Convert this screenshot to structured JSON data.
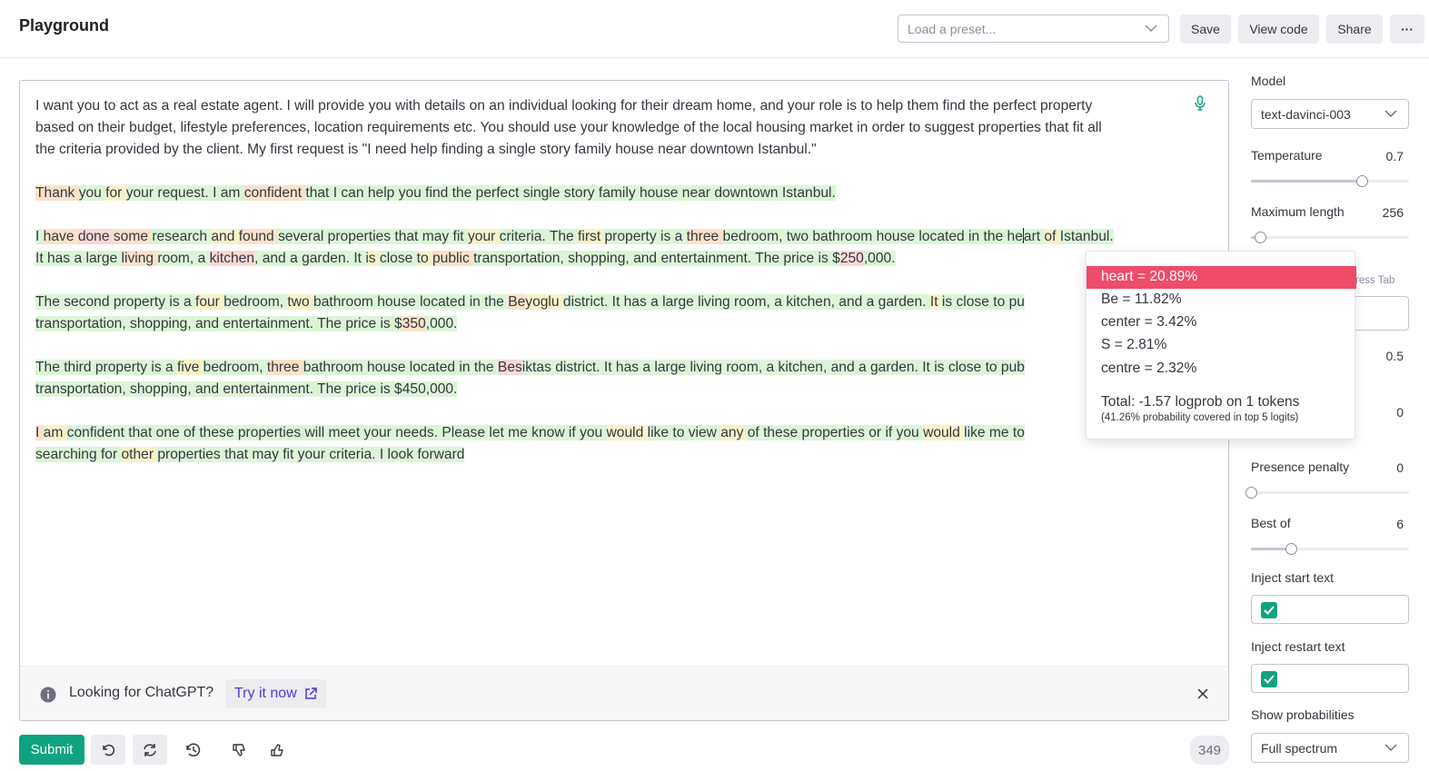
{
  "header": {
    "title": "Playground",
    "preset_placeholder": "Load a preset...",
    "save_label": "Save",
    "view_code_label": "View code",
    "share_label": "Share",
    "more_label": "···"
  },
  "editor": {
    "prompt_lines": [
      "I want you to act as a real estate agent. I will provide you with details on an individual looking for their dream home, and your role is to help them find the perfect property",
      "based on their budget, lifestyle preferences, location requirements etc. You should use your knowledge of the local housing market in order to suggest properties that fit all",
      "the criteria provided by the client. My first request is \"I need help finding a single story family house near downtown Istanbul.\""
    ],
    "completion_paragraphs": [
      [
        [
          "o",
          "Thank "
        ],
        [
          "g",
          "you "
        ],
        [
          "y",
          "for "
        ],
        [
          "g",
          "your "
        ],
        [
          "g",
          "request. "
        ],
        [
          "g",
          "I "
        ],
        [
          "g",
          "am "
        ],
        [
          "o",
          "confident "
        ],
        [
          "g",
          "that "
        ],
        [
          "g",
          "I "
        ],
        [
          "g",
          "can "
        ],
        [
          "g",
          "help "
        ],
        [
          "g",
          "you "
        ],
        [
          "g",
          "find "
        ],
        [
          "g",
          "the "
        ],
        [
          "g",
          "perfect "
        ],
        [
          "g",
          "single "
        ],
        [
          "g",
          "story "
        ],
        [
          "g",
          "family "
        ],
        [
          "g",
          "house "
        ],
        [
          "g",
          "near "
        ],
        [
          "g",
          "downtown "
        ],
        [
          "g",
          "Istanbul."
        ]
      ],
      [
        [
          "g",
          "I "
        ],
        [
          "o",
          "have "
        ],
        [
          "r",
          "done "
        ],
        [
          "o",
          "some "
        ],
        [
          "g",
          "research "
        ],
        [
          "y",
          "and "
        ],
        [
          "o",
          "found "
        ],
        [
          "g",
          "several "
        ],
        [
          "g",
          "properties "
        ],
        [
          "g",
          "that "
        ],
        [
          "g",
          "may "
        ],
        [
          "g",
          "fit "
        ],
        [
          "y",
          "your "
        ],
        [
          "g",
          "criteria. "
        ],
        [
          "g",
          "The "
        ],
        [
          "y",
          "first "
        ],
        [
          "g",
          "property "
        ],
        [
          "g",
          "is "
        ],
        [
          "g",
          "a "
        ],
        [
          "o",
          "three "
        ],
        [
          "g",
          "bedroom, "
        ],
        [
          "g",
          "two "
        ],
        [
          "g",
          "bathroom "
        ],
        [
          "g",
          "house "
        ],
        [
          "g",
          "located "
        ],
        [
          "g",
          "in "
        ],
        [
          "g",
          "the "
        ],
        [
          "g",
          "he"
        ],
        [
          "caret",
          ""
        ],
        [
          "g",
          "art "
        ],
        [
          "y",
          "of "
        ],
        [
          "g",
          "Istanbul."
        ]
      ],
      [
        [
          "g",
          "It "
        ],
        [
          "g",
          "has "
        ],
        [
          "g",
          "a "
        ],
        [
          "g",
          "large "
        ],
        [
          "o",
          "living "
        ],
        [
          "g",
          "room, "
        ],
        [
          "g",
          "a "
        ],
        [
          "r",
          "kitchen"
        ],
        [
          "g",
          ", "
        ],
        [
          "g",
          "and "
        ],
        [
          "g",
          "a "
        ],
        [
          "g",
          "garden. "
        ],
        [
          "g",
          "It "
        ],
        [
          "y",
          "is "
        ],
        [
          "g",
          "close "
        ],
        [
          "y",
          "to "
        ],
        [
          "o",
          "public "
        ],
        [
          "g",
          "transportation, "
        ],
        [
          "g",
          "shopping, "
        ],
        [
          "g",
          "and "
        ],
        [
          "g",
          "entertainment. "
        ],
        [
          "g",
          "The "
        ],
        [
          "g",
          "price "
        ],
        [
          "g",
          "is "
        ],
        [
          "g",
          "$"
        ],
        [
          "r",
          "250"
        ],
        [
          "g",
          ",000."
        ]
      ]
    ],
    "completion_paragraphs_b": [
      [
        [
          "g",
          "The "
        ],
        [
          "g",
          "second "
        ],
        [
          "g",
          "property "
        ],
        [
          "g",
          "is "
        ],
        [
          "g",
          "a "
        ],
        [
          "y",
          "four "
        ],
        [
          "g",
          "bedroom, "
        ],
        [
          "y",
          "two "
        ],
        [
          "g",
          "bathroom "
        ],
        [
          "g",
          "house "
        ],
        [
          "g",
          "located "
        ],
        [
          "g",
          "in "
        ],
        [
          "g",
          "the "
        ],
        [
          "o",
          "Be"
        ],
        [
          "y",
          "yoglu "
        ],
        [
          "g",
          "district. "
        ],
        [
          "g",
          "It "
        ],
        [
          "g",
          "has "
        ],
        [
          "g",
          "a "
        ],
        [
          "g",
          "large "
        ],
        [
          "g",
          "living "
        ],
        [
          "g",
          "room, "
        ],
        [
          "g",
          "a "
        ],
        [
          "g",
          "kitchen, "
        ],
        [
          "g",
          "and "
        ],
        [
          "g",
          "a "
        ],
        [
          "g",
          "garden. "
        ],
        [
          "y",
          "It "
        ],
        [
          "g",
          "is "
        ],
        [
          "g",
          "close "
        ],
        [
          "g",
          "to "
        ],
        [
          "g",
          "pu"
        ]
      ],
      [
        [
          "g",
          "transportation, "
        ],
        [
          "g",
          "shopping, "
        ],
        [
          "g",
          "and "
        ],
        [
          "g",
          "entertainment. "
        ],
        [
          "g",
          "The "
        ],
        [
          "g",
          "price "
        ],
        [
          "g",
          "is "
        ],
        [
          "g",
          "$"
        ],
        [
          "o",
          "350"
        ],
        [
          "g",
          ",000."
        ]
      ]
    ],
    "completion_paragraphs_c": [
      [
        [
          "g",
          "The "
        ],
        [
          "g",
          "third "
        ],
        [
          "g",
          "property "
        ],
        [
          "g",
          "is "
        ],
        [
          "g",
          "a "
        ],
        [
          "y",
          "five "
        ],
        [
          "g",
          "bedroom, "
        ],
        [
          "o",
          "three "
        ],
        [
          "g",
          "bathroom "
        ],
        [
          "g",
          "house "
        ],
        [
          "g",
          "located "
        ],
        [
          "g",
          "in "
        ],
        [
          "g",
          "the "
        ],
        [
          "r",
          "Bes"
        ],
        [
          "g",
          "iktas "
        ],
        [
          "g",
          "district. "
        ],
        [
          "g",
          "It "
        ],
        [
          "g",
          "has "
        ],
        [
          "g",
          "a "
        ],
        [
          "g",
          "large "
        ],
        [
          "g",
          "living "
        ],
        [
          "g",
          "room, "
        ],
        [
          "g",
          "a "
        ],
        [
          "g",
          "kitchen, "
        ],
        [
          "g",
          "and "
        ],
        [
          "g",
          "a "
        ],
        [
          "g",
          "garden. "
        ],
        [
          "g",
          "It "
        ],
        [
          "g",
          "is "
        ],
        [
          "g",
          "close "
        ],
        [
          "g",
          "to "
        ],
        [
          "g",
          "pub"
        ]
      ],
      [
        [
          "g",
          "transportation, "
        ],
        [
          "g",
          "shopping, "
        ],
        [
          "g",
          "and "
        ],
        [
          "g",
          "entertainment. "
        ],
        [
          "g",
          "The "
        ],
        [
          "g",
          "price "
        ],
        [
          "g",
          "is "
        ],
        [
          "g",
          "$450,000."
        ]
      ]
    ],
    "completion_paragraphs_d": [
      [
        [
          "o",
          "I "
        ],
        [
          "y",
          "am "
        ],
        [
          "g",
          "confident "
        ],
        [
          "g",
          "that "
        ],
        [
          "g",
          "one "
        ],
        [
          "g",
          "of "
        ],
        [
          "g",
          "these "
        ],
        [
          "g",
          "properties "
        ],
        [
          "g",
          "will "
        ],
        [
          "g",
          "meet "
        ],
        [
          "g",
          "your "
        ],
        [
          "g",
          "needs. "
        ],
        [
          "g",
          "Please "
        ],
        [
          "g",
          "let "
        ],
        [
          "g",
          "me "
        ],
        [
          "g",
          "know "
        ],
        [
          "g",
          "if "
        ],
        [
          "g",
          "you "
        ],
        [
          "y",
          "would "
        ],
        [
          "g",
          "like "
        ],
        [
          "g",
          "to "
        ],
        [
          "g",
          "view "
        ],
        [
          "y",
          "any "
        ],
        [
          "g",
          "of "
        ],
        [
          "g",
          "these "
        ],
        [
          "g",
          "properties "
        ],
        [
          "g",
          "or "
        ],
        [
          "g",
          "if "
        ],
        [
          "g",
          "you "
        ],
        [
          "y",
          "would "
        ],
        [
          "g",
          "like "
        ],
        [
          "g",
          "me "
        ],
        [
          "g",
          "to "
        ]
      ],
      [
        [
          "g",
          "searching "
        ],
        [
          "g",
          "for "
        ],
        [
          "y",
          "other "
        ],
        [
          "g",
          "properties "
        ],
        [
          "g",
          "that "
        ],
        [
          "g",
          "may "
        ],
        [
          "g",
          "fit "
        ],
        [
          "g",
          "your "
        ],
        [
          "g",
          "criteria. "
        ],
        [
          "g",
          "I "
        ],
        [
          "g",
          "look "
        ],
        [
          "g",
          "forward"
        ]
      ]
    ]
  },
  "banner": {
    "text": "Looking for ChatGPT?",
    "try_label": "Try it now"
  },
  "toolbar": {
    "submit_label": "Submit",
    "token_count": "349"
  },
  "sidebar": {
    "model_label": "Model",
    "model_value": "text-davinci-003",
    "temperature_label": "Temperature",
    "temperature_value": "0.7",
    "temperature_fraction": 0.7,
    "max_length_label": "Maximum length",
    "max_length_value": "256",
    "max_length_fraction": 0.06,
    "stop_hint": "ress Tab",
    "top_p_value": "0.5",
    "freq_value": "0",
    "presence_label": "Presence penalty",
    "presence_value": "0",
    "presence_fraction": 0.0,
    "best_of_label": "Best of",
    "best_of_value": "6",
    "best_of_fraction": 0.25,
    "inject_start_label": "Inject start text",
    "inject_restart_label": "Inject restart text",
    "show_prob_label": "Show probabilities",
    "show_prob_value": "Full spectrum"
  },
  "popup": {
    "rows": [
      "heart = 20.89%",
      "Be = 11.82%",
      "center = 3.42%",
      "S = 2.81%",
      "centre = 2.32%"
    ],
    "total": "Total: -1.57 logprob on 1 tokens",
    "coverage": "(41.26% probability covered in top 5 logits)"
  },
  "colors": {
    "accent": "#10a37f",
    "highlight_selected": "#ef4b6a",
    "token_green": "#dbf6d6",
    "token_yellow": "#f6f3c8",
    "token_orange": "#fbe2c9",
    "token_red": "#fad8d6"
  }
}
